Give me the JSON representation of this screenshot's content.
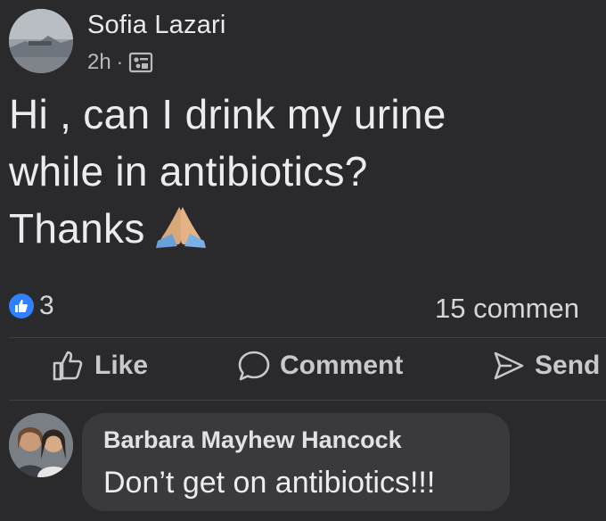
{
  "post": {
    "author": "Sofia Lazari",
    "time": "2h",
    "separator": "·",
    "audience_icon": "photo-album-icon",
    "lines": [
      "Hi , can I drink my urine",
      "while in antibiotics?",
      "Thanks"
    ],
    "emoji": "folded-hands-icon"
  },
  "stats": {
    "likes": "3",
    "comments": "15 commen"
  },
  "actions": {
    "like": "Like",
    "comment": "Comment",
    "send": "Send"
  },
  "comment": {
    "author": "Barbara Mayhew Hancock",
    "text": "Don’t get on antibiotics!!!"
  },
  "colors": {
    "background": "#2a2a2d",
    "bubble": "#3a3a3e",
    "like_blue": "#2f80ff",
    "text": "#ececef"
  }
}
